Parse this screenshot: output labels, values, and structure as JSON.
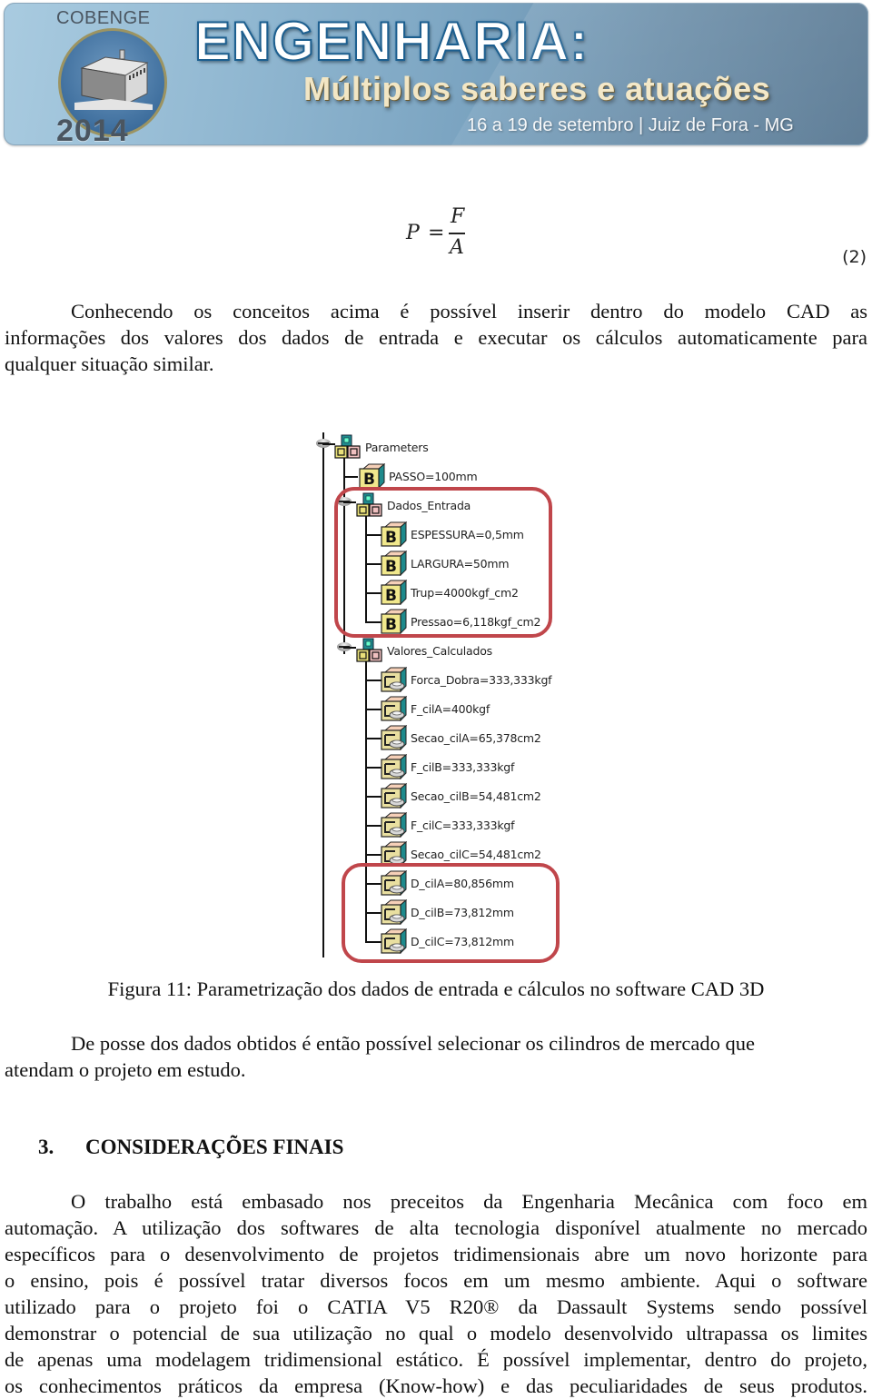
{
  "banner": {
    "org": "COBENGE",
    "year": "2014",
    "title": "ENGENHARIA:",
    "subtitle": "Múltiplos saberes e atuações",
    "date_location": "16 a 19 de setembro | Juiz de Fora - MG",
    "colors": {
      "title_outline": "#1d5f8f",
      "subtitle": "#f2e6c4",
      "background": "#7aa3c0"
    }
  },
  "equation": {
    "lhs": "P",
    "equals": "=",
    "numerator": "F",
    "denominator": "A",
    "number": "(2)"
  },
  "paragraph_1": {
    "lines": [
      "Conhecendo os conceitos acima é possível inserir dentro do modelo CAD as",
      "informações dos valores dos dados de entrada e executar os cálculos automaticamente para",
      "qualquer situação similar."
    ]
  },
  "figure": {
    "highlight_color": "#c0464b",
    "root": {
      "label": "Parameters",
      "icon": "parameter-set-icon"
    },
    "items": [
      {
        "label": "PASSO=100mm",
        "icon": "boolean-parameter-icon"
      }
    ],
    "groups": [
      {
        "label": "Dados_Entrada",
        "icon": "parameter-set-icon",
        "highlighted": true,
        "items": [
          {
            "label": "ESPESSURA=0,5mm",
            "icon": "boolean-parameter-icon"
          },
          {
            "label": "LARGURA=50mm",
            "icon": "boolean-parameter-icon"
          },
          {
            "label": "Trup=4000kgf_cm2",
            "icon": "boolean-parameter-icon"
          },
          {
            "label": "Pressao=6,118kgf_cm2",
            "icon": "boolean-parameter-icon"
          }
        ]
      },
      {
        "label": "Valores_Calculados",
        "icon": "parameter-set-icon",
        "highlighted": false,
        "items": [
          {
            "label": "Forca_Dobra=333,333kgf",
            "icon": "formula-parameter-icon"
          },
          {
            "label": "F_cilA=400kgf",
            "icon": "formula-parameter-icon"
          },
          {
            "label": "Secao_cilA=65,378cm2",
            "icon": "formula-parameter-icon"
          },
          {
            "label": "F_cilB=333,333kgf",
            "icon": "formula-parameter-icon"
          },
          {
            "label": "Secao_cilB=54,481cm2",
            "icon": "formula-parameter-icon"
          },
          {
            "label": "F_cilC=333,333kgf",
            "icon": "formula-parameter-icon"
          },
          {
            "label": "Secao_cilC=54,481cm2",
            "icon": "formula-parameter-icon"
          },
          {
            "label": "D_cilA=80,856mm",
            "icon": "formula-parameter-icon",
            "highlighted": true
          },
          {
            "label": "D_cilB=73,812mm",
            "icon": "formula-parameter-icon",
            "highlighted": true
          },
          {
            "label": "D_cilC=73,812mm",
            "icon": "formula-parameter-icon",
            "highlighted": true
          }
        ]
      }
    ],
    "caption": "Figura 11: Parametrização dos dados de entrada e cálculos no software CAD 3D"
  },
  "paragraph_2": {
    "lines": [
      "De posse dos dados obtidos é então possível selecionar os cilindros de mercado que",
      "atendam o projeto em estudo."
    ]
  },
  "section": {
    "number": "3.",
    "title": "CONSIDERAÇÕES FINAIS"
  },
  "paragraph_3": {
    "lines": [
      "O trabalho está embasado nos preceitos da Engenharia Mecânica com foco em",
      "automação. A utilização dos softwares de alta tecnologia disponível atualmente no mercado",
      "específicos para o desenvolvimento de projetos tridimensionais abre um novo horizonte para",
      "o ensino, pois é possível tratar diversos focos em um mesmo ambiente. Aqui o software",
      "utilizado para o projeto foi o CATIA V5 R20® da Dassault Systems sendo possível",
      "demonstrar o potencial de sua utilização no qual o modelo desenvolvido ultrapassa os limites",
      "de apenas uma modelagem tridimensional estático. É possível implementar, dentro do projeto,",
      "os conhecimentos práticos da empresa (Know-how) e das peculiaridades de seus produtos."
    ]
  }
}
